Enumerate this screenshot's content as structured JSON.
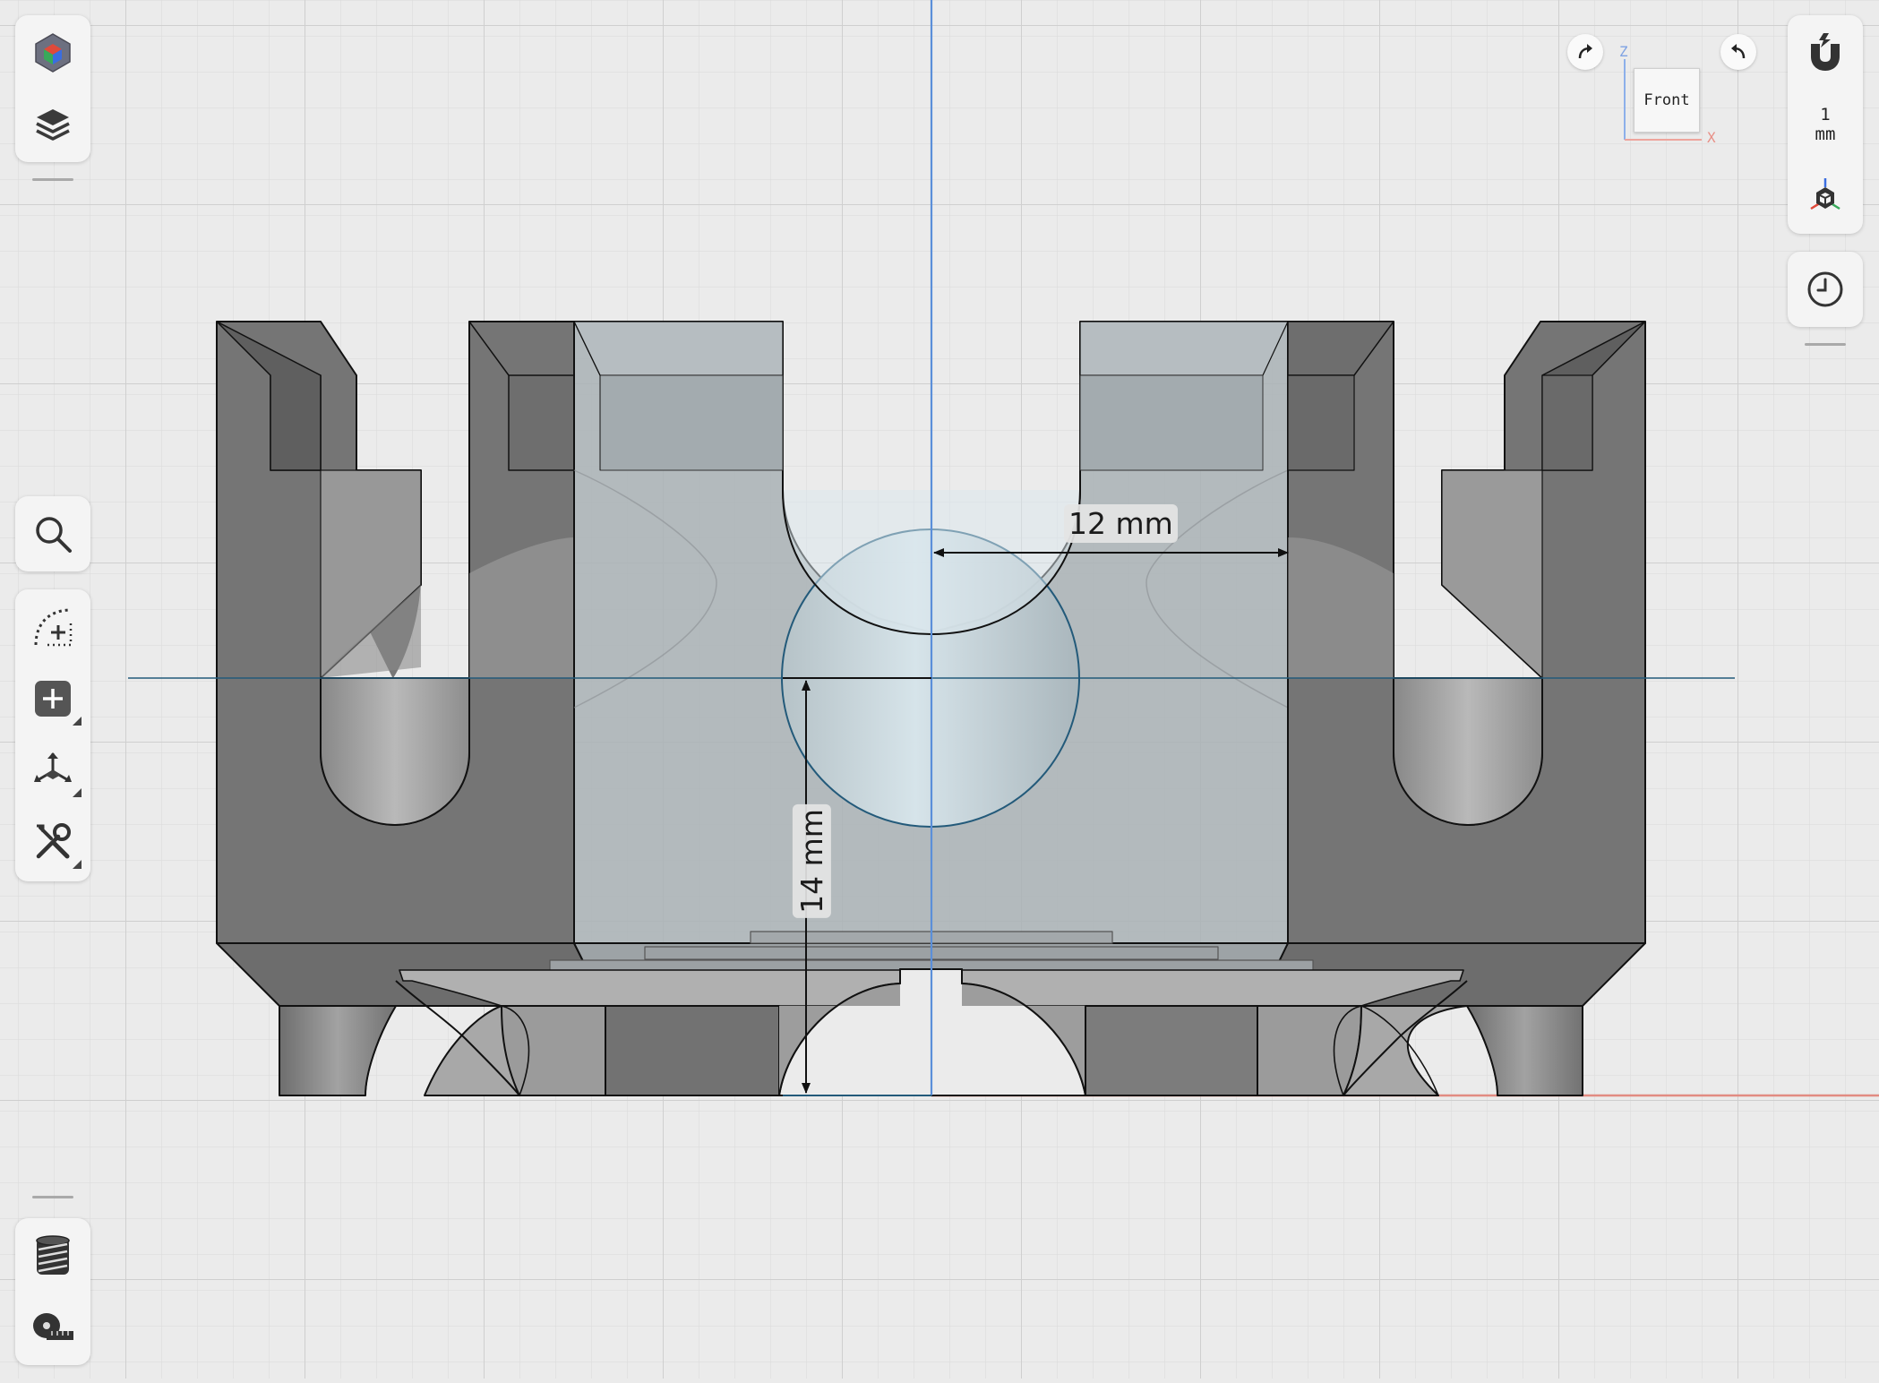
{
  "viewport": {
    "view_cube_label": "Front",
    "axis_z_label": "Z",
    "axis_x_label": "X",
    "grid_size_value": "1",
    "grid_size_unit": "mm"
  },
  "dimensions": {
    "horizontal": "12 mm",
    "vertical": "14 mm"
  },
  "toolbar_left": {
    "top": [
      "scene-icon",
      "layers-icon"
    ],
    "tools": [
      "search-icon",
      "sketch-icon",
      "add-icon",
      "transform-icon",
      "tools-icon"
    ],
    "bottom": [
      "thread-icon",
      "measure-icon"
    ]
  },
  "toolbar_right": [
    "magnet-icon",
    "grid-size",
    "view-axes-icon",
    "history-icon"
  ],
  "colors": {
    "background": "#ebebeb",
    "grid_minor": "#dedede",
    "grid_major": "#d2d2d2",
    "axis_blue": "#5b8fd9",
    "axis_red": "#e08a80",
    "sketch_line": "#235a7a",
    "solid_dark": "#7a7a7a",
    "solid_transparent": "#a9b2b7",
    "sphere": "#cfe2ea"
  }
}
